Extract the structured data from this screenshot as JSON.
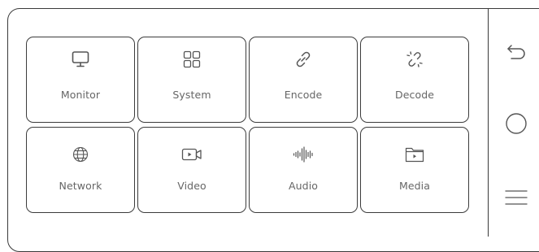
{
  "tiles": [
    {
      "label": "Monitor",
      "icon": "monitor-icon"
    },
    {
      "label": "System",
      "icon": "grid-icon"
    },
    {
      "label": "Encode",
      "icon": "link-icon"
    },
    {
      "label": "Decode",
      "icon": "broken-link-icon"
    },
    {
      "label": "Network",
      "icon": "globe-icon"
    },
    {
      "label": "Video",
      "icon": "video-camera-icon"
    },
    {
      "label": "Audio",
      "icon": "audio-waveform-icon"
    },
    {
      "label": "Media",
      "icon": "folder-play-icon"
    }
  ],
  "side_nav": {
    "back_icon": "back-arrow-icon",
    "home_icon": "circle-home-icon",
    "menu_icon": "hamburger-menu-icon"
  },
  "colors": {
    "border": "#3a3a3a",
    "label_text": "#666666",
    "icon_stroke": "#555555",
    "background": "#ffffff"
  }
}
